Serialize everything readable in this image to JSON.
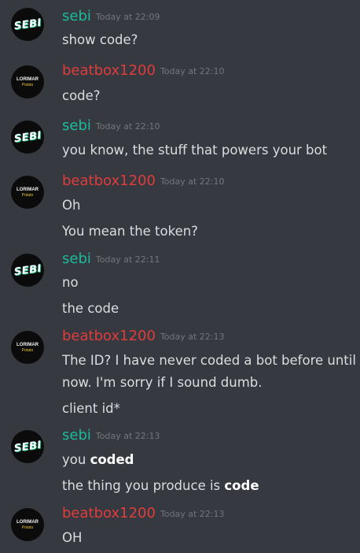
{
  "messages": [
    {
      "user": "sebi",
      "time": "Today at 22:09",
      "lines": [
        "show code?"
      ]
    },
    {
      "user": "beatbox1200",
      "time": "Today at 22:10",
      "lines": [
        "code?"
      ]
    },
    {
      "user": "sebi",
      "time": "Today at 22:10",
      "lines": [
        "you know, the stuff that powers your bot"
      ]
    },
    {
      "user": "beatbox1200",
      "time": "Today at 22:10",
      "lines": [
        "Oh",
        "You mean the token?"
      ]
    },
    {
      "user": "sebi",
      "time": "Today at 22:11",
      "lines": [
        "no",
        "the code"
      ]
    },
    {
      "user": "beatbox1200",
      "time": "Today at 22:13",
      "lines": [
        "The ID? I have never coded a bot before until",
        "now. I'm sorry if I sound dumb.",
        "client id*"
      ]
    },
    {
      "user": "sebi",
      "time": "Today at 22:13",
      "lines": [
        {
          "text": "you ",
          "bold": "coded"
        },
        {
          "text": "the thing you produce is ",
          "bold": "code"
        }
      ]
    },
    {
      "user": "beatbox1200",
      "time": "Today at 22:13",
      "lines": [
        "OH"
      ]
    }
  ],
  "avatar_text": {
    "sebi": "SEBI",
    "beatbox_line1": "LORIMAR",
    "beatbox_line2": "Potato"
  },
  "colors": {
    "background": "#36393f",
    "sebi_name": "#1abc9c",
    "beatbox_name": "#e03c3c",
    "timestamp": "#72767d",
    "text": "#dcddde"
  }
}
